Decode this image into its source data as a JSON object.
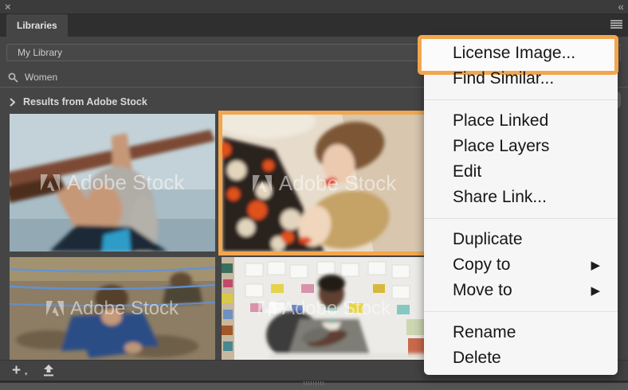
{
  "titlebar": {
    "close_icon": "×",
    "collapse_icon": "«"
  },
  "panel": {
    "tab_label": "Libraries",
    "library_name": "My Library",
    "search_value": "Women",
    "results_header": "Results from Adobe Stock"
  },
  "grid": {
    "watermark": "Adobe Stock",
    "images": [
      {
        "description": "woman with gray hair carrying surfboard by the sea",
        "selected": false
      },
      {
        "description": "two women in retro fashion lying head to head",
        "selected": true
      },
      {
        "description": "woman crawling through mud under ropes",
        "selected": false
      },
      {
        "description": "designer at desk in front of pattern swatch wall",
        "selected": false
      }
    ]
  },
  "context_menu": {
    "submenu_arrow": "▶",
    "groups": [
      {
        "items": [
          {
            "label": "License Image...",
            "highlighted": true
          },
          {
            "label": "Find Similar...",
            "highlighted": false
          }
        ]
      },
      {
        "items": [
          {
            "label": "Place Linked"
          },
          {
            "label": "Place Layers"
          },
          {
            "label": "Edit"
          },
          {
            "label": "Share Link..."
          }
        ]
      },
      {
        "items": [
          {
            "label": "Duplicate"
          },
          {
            "label": "Copy to",
            "has_submenu": true
          },
          {
            "label": "Move to",
            "has_submenu": true
          }
        ]
      },
      {
        "items": [
          {
            "label": "Rename"
          },
          {
            "label": "Delete"
          }
        ]
      }
    ]
  },
  "footer": {
    "add_icon": "+",
    "add_menu_caret": "▾"
  },
  "colors": {
    "accent_orange": "#F2A64E",
    "panel_bg": "#454545",
    "tab_bar_bg": "#2F2F2F",
    "menu_bg": "#F6F6F6",
    "menu_text": "#161616"
  }
}
